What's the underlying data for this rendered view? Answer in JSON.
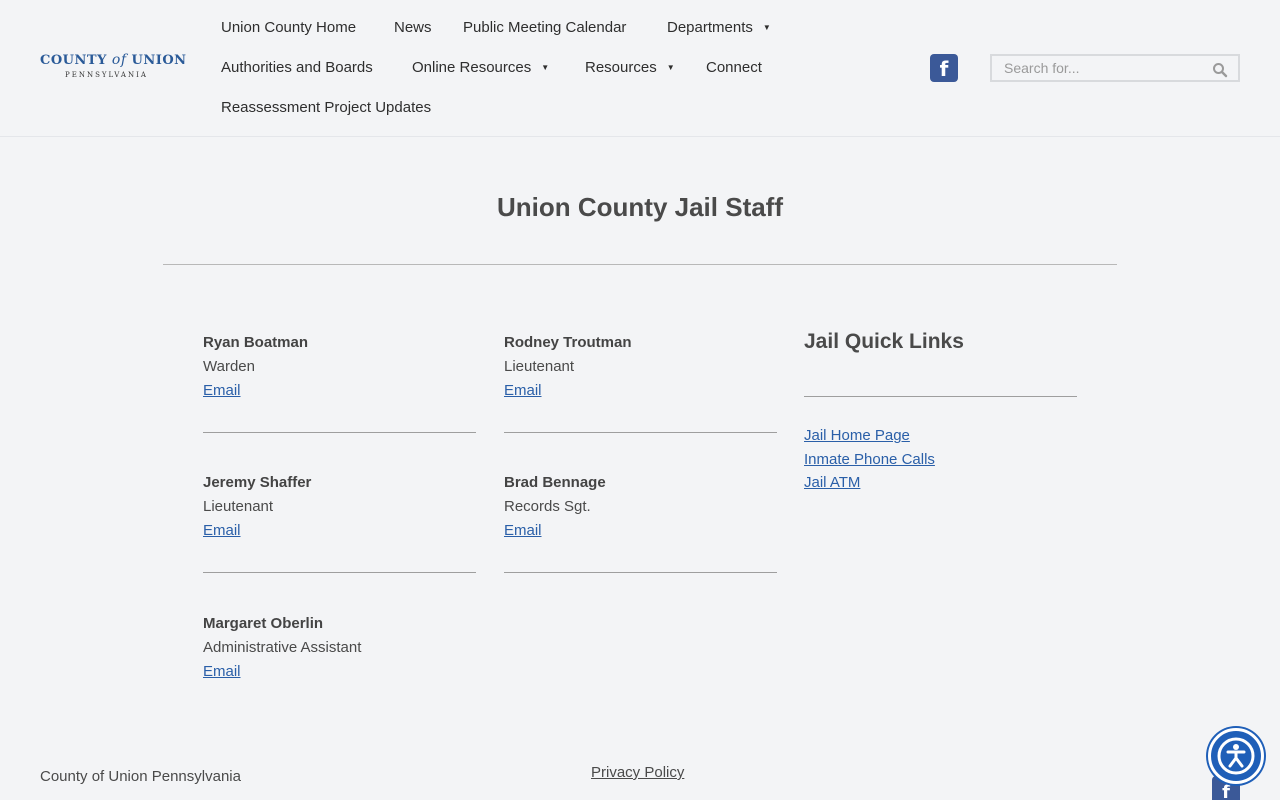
{
  "header": {
    "logo": {
      "top_a": "County",
      "top_of": "of",
      "top_b": "Union",
      "bottom": "PENNSYLVANIA"
    },
    "nav": [
      {
        "label": "Union County Home"
      },
      {
        "label": "News"
      },
      {
        "label": "Public Meeting Calendar"
      },
      {
        "label": "Departments",
        "has_dropdown": true
      },
      {
        "label": "Authorities and Boards"
      },
      {
        "label": "Online Resources",
        "has_dropdown": true
      },
      {
        "label": "Resources",
        "has_dropdown": true
      },
      {
        "label": "Connect"
      },
      {
        "label": "Reassessment Project Updates"
      }
    ],
    "facebook_icon": "facebook-icon",
    "search": {
      "placeholder": "Search for...",
      "value": "",
      "icon": "search-icon"
    }
  },
  "main": {
    "title": "Union County Jail Staff",
    "staff": [
      {
        "name": "Ryan Boatman",
        "role": "Warden",
        "link": "Email"
      },
      {
        "name": "Rodney Troutman",
        "role": "Lieutenant",
        "link": "Email"
      },
      {
        "name": "Jeremy Shaffer",
        "role": "Lieutenant",
        "link": "Email"
      },
      {
        "name": "Brad Bennage",
        "role": "Records Sgt.",
        "link": "Email"
      },
      {
        "name": "Margaret Oberlin",
        "role": "Administrative Assistant",
        "link": "Email"
      }
    ],
    "quick_links": {
      "title": "Jail Quick Links",
      "items": [
        "Jail Home Page",
        "Inmate Phone Calls",
        "Jail ATM"
      ]
    }
  },
  "footer": {
    "left": "County of Union Pennsylvania",
    "center": "Privacy Policy"
  },
  "colors": {
    "link": "#2a5fa8",
    "facebook": "#3b5998",
    "accessibility": "#1f5fb8"
  }
}
